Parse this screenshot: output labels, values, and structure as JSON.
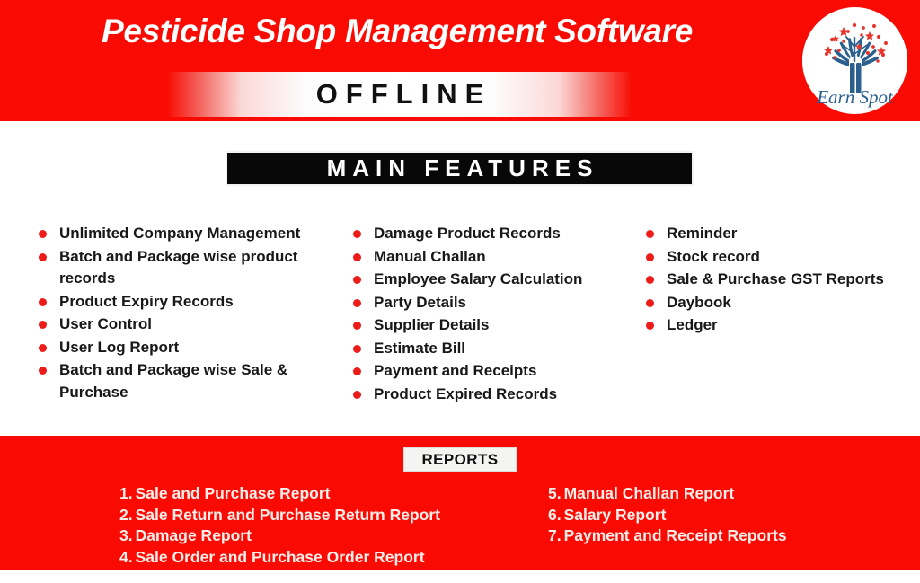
{
  "header": {
    "title": "Pesticide Shop Management Software",
    "offline_label": "OFFLINE",
    "brand_color": "#f90b03",
    "logo": {
      "name": "earn-spot-logo",
      "text": "Earn Spot",
      "tree_color": "#2b5f8e",
      "star_color": "#e8352b"
    }
  },
  "features": {
    "heading": "MAIN FEATURES",
    "bullet_color": "#ee1c18",
    "columns": [
      {
        "items": [
          "Unlimited Company Management",
          "Batch and Package wise product records",
          "Product Expiry Records",
          "User Control",
          "User Log Report",
          "Batch and Package wise Sale & Purchase"
        ]
      },
      {
        "items": [
          "Damage Product Records",
          "Manual Challan",
          "Employee Salary Calculation",
          "Party Details",
          "Supplier Details",
          "Estimate Bill",
          "Payment and Receipts",
          "Product Expired Records"
        ]
      },
      {
        "items": [
          "Reminder",
          "Stock record",
          "Sale & Purchase GST Reports",
          "Daybook",
          "Ledger"
        ]
      }
    ]
  },
  "reports": {
    "heading": "REPORTS",
    "left": [
      {
        "num": "1.",
        "label": "Sale and Purchase Report"
      },
      {
        "num": "2.",
        "label": "Sale Return and Purchase Return Report"
      },
      {
        "num": "3.",
        "label": "Damage Report"
      },
      {
        "num": "4.",
        "label": "Sale Order and Purchase Order Report"
      }
    ],
    "right": [
      {
        "num": "5.",
        "label": "Manual Challan Report"
      },
      {
        "num": "6.",
        "label": "Salary Report"
      },
      {
        "num": "7.",
        "label": "Payment and Receipt Reports"
      }
    ]
  }
}
